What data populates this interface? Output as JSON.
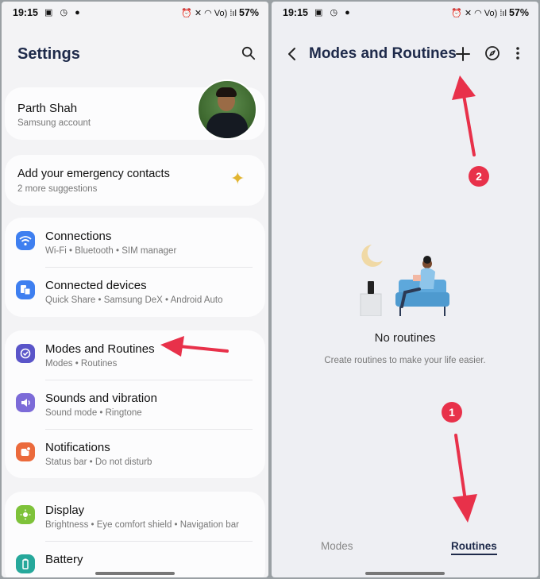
{
  "left_screen": {
    "status": {
      "time": "19:15",
      "left_icons": "▣ ◷ ●",
      "right_icons": "⏰ ✕ ◠ Vo) ⁞ıl",
      "battery": "57%"
    },
    "title": "Settings",
    "account": {
      "name": "Parth Shah",
      "subtitle": "Samsung account"
    },
    "suggestion": {
      "title": "Add your emergency contacts",
      "subtitle": "2 more suggestions"
    },
    "items": [
      {
        "label": "Connections",
        "sub": "Wi-Fi  •  Bluetooth  •  SIM manager",
        "icon": "wifi-icon",
        "color": "#3e7ff0"
      },
      {
        "label": "Connected devices",
        "sub": "Quick Share  •  Samsung DeX  •  Android Auto",
        "icon": "devices-icon",
        "color": "#3e7ff0"
      },
      {
        "label": "Modes and Routines",
        "sub": "Modes  •  Routines",
        "icon": "check-circle-icon",
        "color": "#5a55c9"
      },
      {
        "label": "Sounds and vibration",
        "sub": "Sound mode  •  Ringtone",
        "icon": "volume-icon",
        "color": "#7c6bd8"
      },
      {
        "label": "Notifications",
        "sub": "Status bar  •  Do not disturb",
        "icon": "bell-icon",
        "color": "#eb6a3c"
      },
      {
        "label": "Display",
        "sub": "Brightness  •  Eye comfort shield  •  Navigation bar",
        "icon": "sun-icon",
        "color": "#7ec23a"
      },
      {
        "label": "Battery",
        "sub": "",
        "icon": "battery-icon",
        "color": "#26a89b"
      }
    ]
  },
  "right_screen": {
    "status": {
      "time": "19:15",
      "left_icons": "▣ ◷ ●",
      "right_icons": "⏰ ✕ ◠ Vo) ⁞ıl",
      "battery": "57%"
    },
    "title": "Modes and Routines",
    "empty_title": "No routines",
    "empty_subtitle": "Create routines to make your life easier.",
    "tabs": {
      "modes": "Modes",
      "routines": "Routines"
    }
  },
  "annotations": {
    "badge1": "1",
    "badge2": "2",
    "arrow_color": "#e8314a"
  }
}
